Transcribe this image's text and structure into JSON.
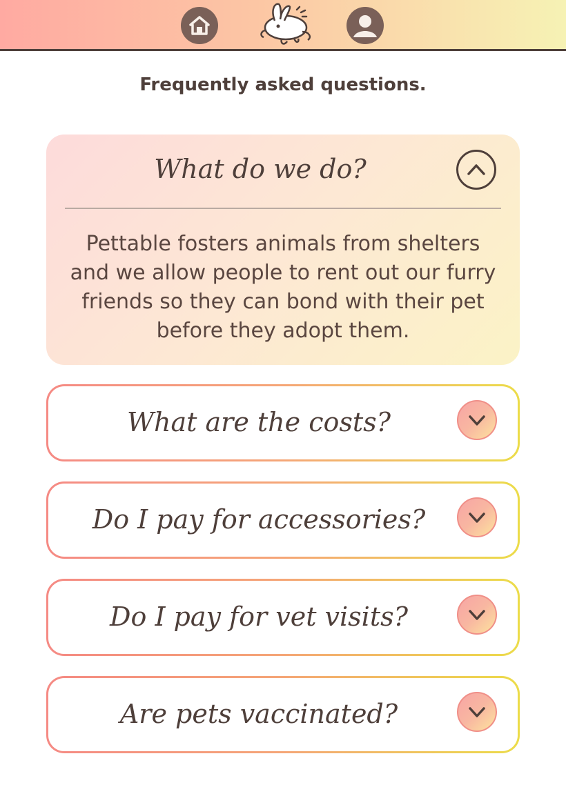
{
  "nav": {
    "home_icon": "home-icon",
    "logo_icon": "bunny-logo-icon",
    "profile_icon": "user-icon"
  },
  "page": {
    "heading": "Frequently asked questions."
  },
  "faqs": [
    {
      "question": "What do we do?",
      "answer": "Pettable fosters animals from shelters and we allow people to rent out our furry friends so they can bond with their pet before they adopt them.",
      "expanded": true
    },
    {
      "question": "What are the costs?",
      "expanded": false
    },
    {
      "question": "Do I pay for accessories?",
      "expanded": false
    },
    {
      "question": "Do I pay for vet visits?",
      "expanded": false
    },
    {
      "question": "Are pets vaccinated?",
      "expanded": false
    }
  ],
  "colors": {
    "header_gradient_start": "#ffaaa2",
    "header_gradient_end": "#f6f2b4",
    "text_dark": "#4e3f3a",
    "icon_brown": "#7a6058",
    "card_border_start": "#f58a84",
    "card_border_end": "#ecdc4a"
  }
}
